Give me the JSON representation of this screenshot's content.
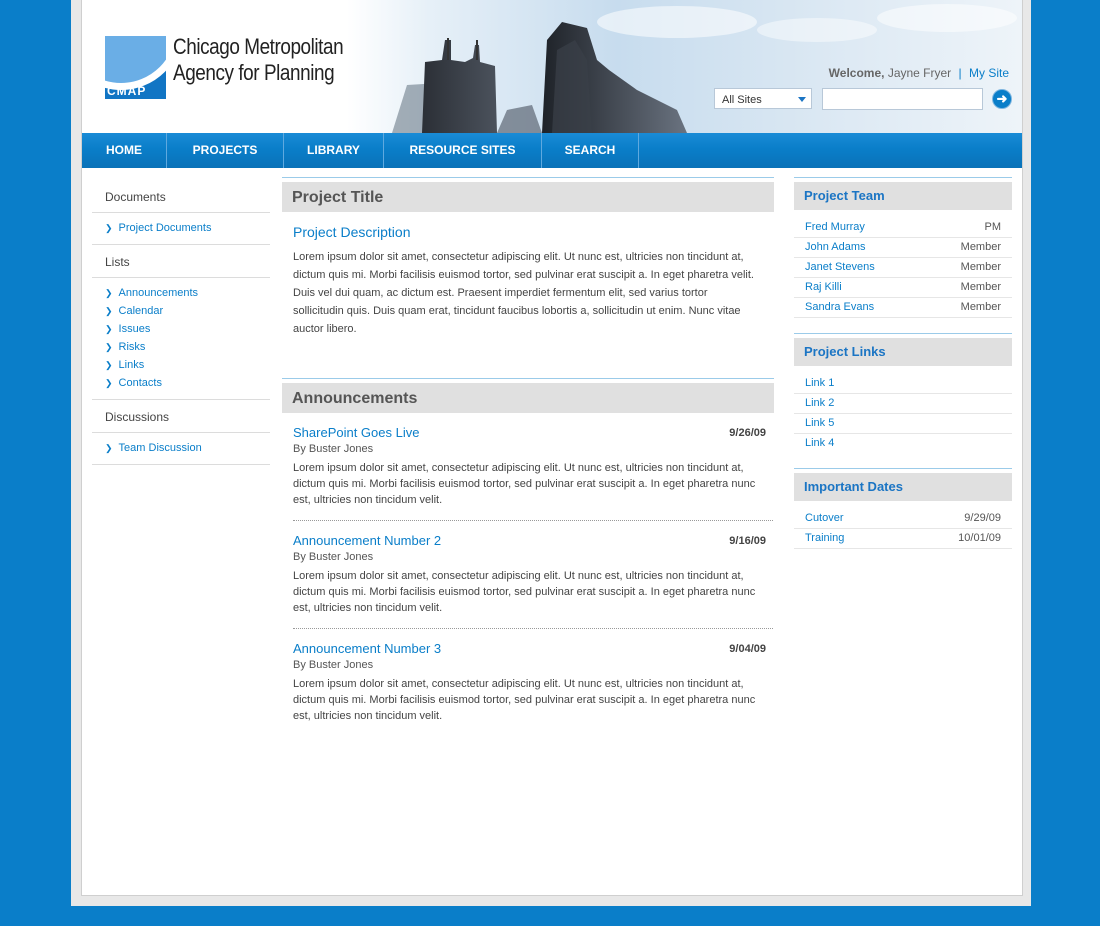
{
  "header": {
    "logo_line1": "Chicago Metropolitan",
    "logo_line2": "Agency for Planning",
    "logo_abbr": "CMAP",
    "welcome_label": "Welcome,",
    "user_name": "Jayne Fryer",
    "separator": "|",
    "my_site": "My Site",
    "scope_select": "All Sites",
    "search_value": ""
  },
  "nav": [
    "HOME",
    "PROJECTS",
    "LIBRARY",
    "RESOURCE SITES",
    "SEARCH"
  ],
  "sidebar": {
    "documents_heading": "Documents",
    "documents": [
      "Project Documents"
    ],
    "lists_heading": "Lists",
    "lists": [
      "Announcements",
      "Calendar",
      "Issues",
      "Risks",
      "Links",
      "Contacts"
    ],
    "discussions_heading": "Discussions",
    "discussions": [
      "Team Discussion"
    ]
  },
  "main": {
    "project_title": "Project Title",
    "description_title": "Project Description",
    "description": "Lorem ipsum dolor sit amet, consectetur adipiscing elit. Ut nunc est, ultricies non tincidunt at, dictum quis mi. Morbi facilisis euismod tortor, sed pulvinar erat suscipit a. In eget pharetra velit. Duis vel dui quam, ac dictum est. Praesent imperdiet fermentum elit, sed varius tortor sollicitudin quis. Duis quam erat, tincidunt faucibus lobortis a, sollicitudin ut enim. Nunc vitae auctor libero.",
    "announcements_title": "Announcements",
    "announcements": [
      {
        "title": "SharePoint Goes Live",
        "date": "9/26/09",
        "by": "By Buster Jones",
        "body": "Lorem ipsum dolor sit amet, consectetur adipiscing elit. Ut nunc est, ultricies non tincidunt at, dictum quis mi. Morbi facilisis euismod tortor, sed pulvinar erat suscipit a. In eget pharetra nunc est, ultricies non tincidum velit."
      },
      {
        "title": "Announcement Number 2",
        "date": "9/16/09",
        "by": "By Buster Jones",
        "body": "Lorem ipsum dolor sit amet, consectetur adipiscing elit. Ut nunc est, ultricies non tincidunt at, dictum quis mi. Morbi facilisis euismod tortor, sed pulvinar erat suscipit a. In eget pharetra nunc est, ultricies non tincidum velit."
      },
      {
        "title": "Announcement Number 3",
        "date": "9/04/09",
        "by": "By Buster Jones",
        "body": "Lorem ipsum dolor sit amet, consectetur adipiscing elit. Ut nunc est, ultricies non tincidunt at, dictum quis mi. Morbi facilisis euismod tortor, sed pulvinar erat suscipit a. In eget pharetra nunc est, ultricies non tincidum velit."
      }
    ]
  },
  "right": {
    "team_title": "Project Team",
    "team": [
      {
        "name": "Fred Murray",
        "role": "PM"
      },
      {
        "name": "John Adams",
        "role": "Member"
      },
      {
        "name": "Janet Stevens",
        "role": "Member"
      },
      {
        "name": "Raj Killi",
        "role": "Member"
      },
      {
        "name": "Sandra Evans",
        "role": "Member"
      }
    ],
    "links_title": "Project Links",
    "links": [
      "Link 1",
      "Link 2",
      "Link 5",
      "Link 4"
    ],
    "dates_title": "Important Dates",
    "dates": [
      {
        "name": "Cutover",
        "date": "9/29/09"
      },
      {
        "name": "Training",
        "date": "10/01/09"
      }
    ]
  },
  "colors": {
    "brand_blue": "#0a7ec9",
    "panel_gray": "#e0e0e0"
  }
}
